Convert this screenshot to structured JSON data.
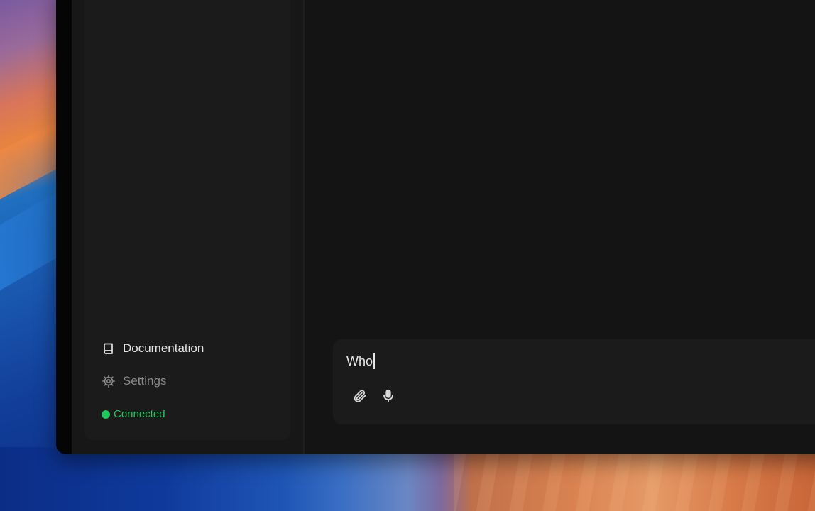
{
  "sidebar": {
    "items": [
      {
        "label": "Documentation",
        "icon": "book-icon"
      },
      {
        "label": "Settings",
        "icon": "gear-icon"
      }
    ],
    "status": {
      "label": "Connected",
      "color": "#22c55e"
    }
  },
  "composer": {
    "value": "Who",
    "tools": [
      {
        "icon": "paperclip-icon"
      },
      {
        "icon": "microphone-icon"
      }
    ]
  },
  "colors": {
    "window_bg": "#141415",
    "sidebar_bg": "#1b1b1c",
    "text_primary": "#e6e6e6",
    "text_muted": "#8a8a8a",
    "status_green": "#22c55e"
  }
}
